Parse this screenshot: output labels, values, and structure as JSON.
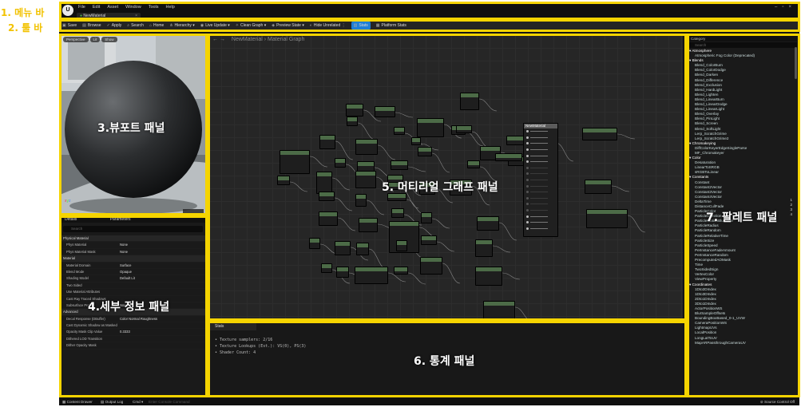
{
  "colors": {
    "editor_bg": "#151515",
    "annotation": "#f5d400",
    "accent": "#1e7fd6",
    "node_header": "#4c6b47"
  },
  "annotations": {
    "menu_bar": "1. 메뉴 바",
    "toolbar": "2. 툴 바",
    "viewport": "3.뷰포트 패널",
    "details": "4.세부 정보 패널",
    "graph": "5. 머티리얼 그래프 패널",
    "stats": "6. 통계 패널",
    "palette": "7. 팔레트 패널"
  },
  "menu": [
    "File",
    "Edit",
    "Asset",
    "Window",
    "Tools",
    "Help"
  ],
  "tab": {
    "title": "NewMaterial"
  },
  "toolbar": {
    "items": [
      {
        "icon": "save-icon",
        "label": "Save"
      },
      {
        "icon": "browse-icon",
        "label": "Browse"
      },
      {
        "icon": "apply-icon",
        "label": "Apply"
      },
      {
        "icon": "search-icon",
        "label": "Search"
      },
      {
        "icon": "home-icon",
        "label": "Home"
      },
      {
        "icon": "hierarchy-icon",
        "label": "Hierarchy ▾"
      },
      {
        "icon": "live-update-icon",
        "label": "Live Update ▾"
      },
      {
        "icon": "clean-graph-icon",
        "label": "Clean Graph ▾"
      },
      {
        "icon": "preview-state-icon",
        "label": "Preview State ▾"
      },
      {
        "icon": "hide-unrelated-icon",
        "label": "Hide Unrelated ⋮"
      },
      {
        "icon": "stats-icon",
        "label": "Stats"
      },
      {
        "icon": "platform-stats-icon",
        "label": "Platform Stats"
      }
    ]
  },
  "viewport": {
    "buttons": [
      "Perspective",
      "Lit",
      "Show"
    ]
  },
  "details": {
    "tabs": [
      "Details",
      "Parameters"
    ],
    "search_placeholder": "Search",
    "rows": [
      {
        "label": "Physical Material",
        "value": "",
        "section": true
      },
      {
        "label": "Phys Material",
        "value": "None"
      },
      {
        "label": "Phys Material Mask",
        "value": "None"
      },
      {
        "label": "Material",
        "value": "",
        "section": true
      },
      {
        "label": "Material Domain",
        "value": "Surface"
      },
      {
        "label": "Blend Mode",
        "value": "Opaque"
      },
      {
        "label": "Shading Model",
        "value": "Default Lit"
      },
      {
        "label": "Two Sided",
        "value": ""
      },
      {
        "label": "Use Material Attributes",
        "value": ""
      },
      {
        "label": "Cast Ray Traced Shadows",
        "value": ""
      },
      {
        "label": "Subsurface Profile",
        "value": "None"
      },
      {
        "label": "Advanced",
        "value": "",
        "section": true
      },
      {
        "label": "Decal Response (DBuffer)",
        "value": "Color Normal Roughness"
      },
      {
        "label": "Cast Dynamic Shadow as Masked",
        "value": ""
      },
      {
        "label": "Opacity Mask Clip Value",
        "value": "0.3333"
      },
      {
        "label": "Dithered LOD Transition",
        "value": ""
      },
      {
        "label": "Dither Opacity Mask",
        "value": ""
      }
    ]
  },
  "graph": {
    "breadcrumb": "NewMaterial",
    "breadcrumb_child": "Material Graph",
    "output_node": "NewMaterial"
  },
  "stats": {
    "tab": "Stats",
    "lines": [
      "• Texture samplers: 2/16",
      "• Texture Lookups (Est.): VS(0), PS(3)",
      "• Shader Count: 4"
    ]
  },
  "palette": {
    "category_filter": "Category",
    "search_placeholder": "Search",
    "entries": [
      {
        "t": "Atmosphere",
        "cat": true
      },
      {
        "t": "Atmospheric Fog Color (Deprecated)"
      },
      {
        "t": "Blends",
        "cat": true
      },
      {
        "t": "Blend_ColorBurn"
      },
      {
        "t": "Blend_ColorDodge"
      },
      {
        "t": "Blend_Darken"
      },
      {
        "t": "Blend_Difference"
      },
      {
        "t": "Blend_Exclusion"
      },
      {
        "t": "Blend_HardLight"
      },
      {
        "t": "Blend_Lighten"
      },
      {
        "t": "Blend_LinearBurn"
      },
      {
        "t": "Blend_LinearDodge"
      },
      {
        "t": "Blend_LinearLight"
      },
      {
        "t": "Blend_Overlay"
      },
      {
        "t": "Blend_PinLight"
      },
      {
        "t": "Blend_Screen"
      },
      {
        "t": "Blend_SoftLight"
      },
      {
        "t": "Lerp_ScratchGrime"
      },
      {
        "t": "Lerp_ScratchGrime2"
      },
      {
        "t": "Chromakeying",
        "cat": true
      },
      {
        "t": "DiffColorKeyerEdgeSingleParse"
      },
      {
        "t": "MF_Chromakeyer"
      },
      {
        "t": "Color",
        "cat": true
      },
      {
        "t": "Desaturation"
      },
      {
        "t": "LinearToSRGB"
      },
      {
        "t": "sRGBToLinear"
      },
      {
        "t": "Constants",
        "cat": true
      },
      {
        "t": "Constant"
      },
      {
        "t": "Constant2Vector"
      },
      {
        "t": "Constant3Vector"
      },
      {
        "t": "Constant4Vector"
      },
      {
        "t": "DeltaTime"
      },
      {
        "t": "DistanceCullFade"
      },
      {
        "t": "ParticleColor"
      },
      {
        "t": "ParticleDirection"
      },
      {
        "t": "ParticleMotionBlurFade"
      },
      {
        "t": "ParticleRadius"
      },
      {
        "t": "ParticleRandom"
      },
      {
        "t": "ParticleRelativeTime"
      },
      {
        "t": "ParticleSize"
      },
      {
        "t": "ParticleSpeed"
      },
      {
        "t": "PerInstanceFadeAmount"
      },
      {
        "t": "PerInstanceRandom"
      },
      {
        "t": "PrecomputedAOMask"
      },
      {
        "t": "Time"
      },
      {
        "t": "TwoSidedSign"
      },
      {
        "t": "VertexColor"
      },
      {
        "t": "ViewProperty"
      },
      {
        "t": "Coordinates",
        "cat": true
      },
      {
        "t": "1Dto2DIndex"
      },
      {
        "t": "1Dto3DIndex"
      },
      {
        "t": "2Dto1DIndex"
      },
      {
        "t": "3Dto1DIndex"
      },
      {
        "t": "ActorPositionWS"
      },
      {
        "t": "BlurSampleOffsets"
      },
      {
        "t": "BoundingBoxBased_0-1_UVW"
      },
      {
        "t": "CameraPositionWS"
      },
      {
        "t": "LightmapUVs"
      },
      {
        "t": "LocalPosition"
      },
      {
        "t": "LongLatToUV"
      },
      {
        "t": "MapARPassthroughCameraUV"
      }
    ],
    "shortcuts": [
      "1",
      "2",
      "3",
      "4"
    ]
  },
  "statusbar": {
    "content_drawer": "Content Drawer",
    "output_log": "Output Log",
    "cmd": "Cmd ▾",
    "cmd_placeholder": "Enter Console Command",
    "source_control": "Source Control Off"
  }
}
